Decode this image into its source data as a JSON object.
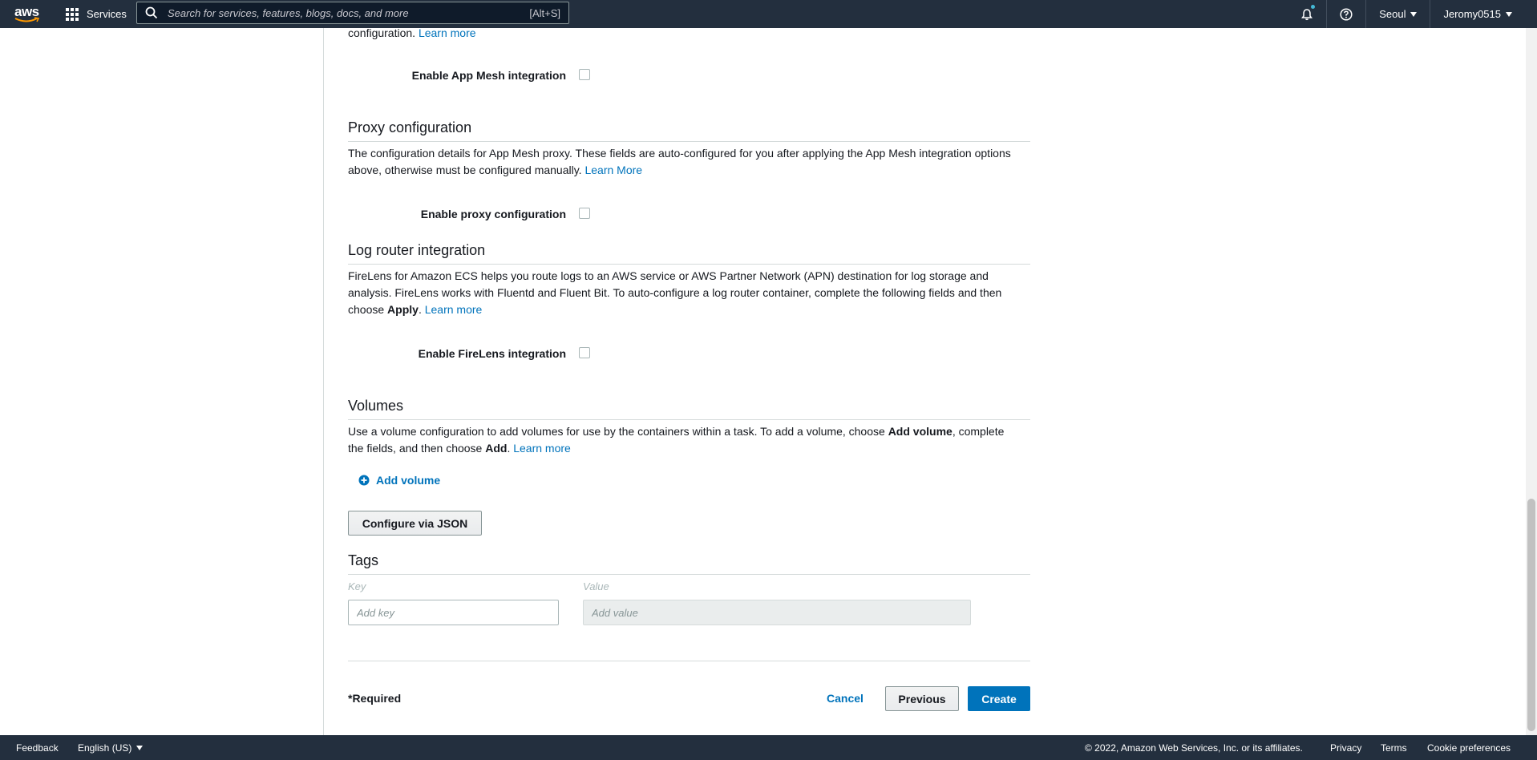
{
  "topnav": {
    "logo_text": "aws",
    "services_label": "Services",
    "search_placeholder": "Search for services, features, blogs, docs, and more",
    "search_shortcut": "[Alt+S]",
    "region": "Seoul",
    "user": "Jeromy0515"
  },
  "app_mesh": {
    "desc_tail": "configuration.",
    "learn_more": "Learn more",
    "enable_label": "Enable App Mesh integration"
  },
  "proxy": {
    "title": "Proxy configuration",
    "desc_line1": "The configuration details for App Mesh proxy. These fields are auto-configured for you after applying the App Mesh integration options",
    "desc_line2": "above, otherwise must be configured manually.",
    "learn_more": "Learn More",
    "enable_label": "Enable proxy configuration"
  },
  "log_router": {
    "title": "Log router integration",
    "desc_line1": "FireLens for Amazon ECS helps you route logs to an AWS service or AWS Partner Network (APN) destination for log storage and",
    "desc_line2": "analysis. FireLens works with Fluentd and Fluent Bit. To auto-configure a log router container, complete the following fields and then",
    "desc_line3_pre": "choose",
    "desc_line3_bold": "Apply",
    "desc_line3_post": ".",
    "learn_more": "Learn more",
    "enable_label": "Enable FireLens integration"
  },
  "volumes": {
    "title": "Volumes",
    "desc_line1_pre": "Use a volume configuration to add volumes for use by the containers within a task. To add a volume, choose",
    "desc_line1_bold": "Add volume",
    "desc_line1_post": ", complete",
    "desc_line2_pre": "the fields, and then choose",
    "desc_line2_bold": "Add",
    "desc_line2_post": ".",
    "learn_more": "Learn more",
    "add_volume": "Add volume"
  },
  "configure_json": "Configure via JSON",
  "tags": {
    "title": "Tags",
    "key_header": "Key",
    "value_header": "Value",
    "key_placeholder": "Add key",
    "value_placeholder": "Add value"
  },
  "actions": {
    "required_note": "*Required",
    "cancel": "Cancel",
    "previous": "Previous",
    "create": "Create"
  },
  "footer": {
    "feedback": "Feedback",
    "language": "English (US)",
    "copyright": "© 2022, Amazon Web Services, Inc. or its affiliates.",
    "privacy": "Privacy",
    "terms": "Terms",
    "cookies": "Cookie preferences"
  },
  "colors": {
    "nav_bg": "#232f3e",
    "link": "#0073bb",
    "primary": "#0073bb"
  }
}
